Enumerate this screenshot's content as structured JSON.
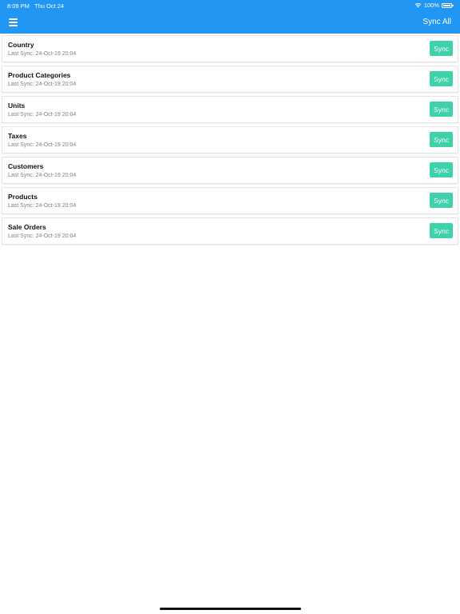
{
  "status_bar": {
    "time": "8:09 PM",
    "date": "Thu Oct 24",
    "battery": "100%"
  },
  "header": {
    "sync_all_label": "Sync All"
  },
  "items": [
    {
      "title": "Country",
      "last_sync": "Last Sync: 24-Oct-19 20:04",
      "button": "Sync"
    },
    {
      "title": "Product Categories",
      "last_sync": "Last Sync: 24-Oct-19 20:04",
      "button": "Sync"
    },
    {
      "title": "Units",
      "last_sync": "Last Sync: 24-Oct-19 20:04",
      "button": "Sync"
    },
    {
      "title": "Taxes",
      "last_sync": "Last Sync: 24-Oct-19 20:04",
      "button": "Sync"
    },
    {
      "title": "Customers",
      "last_sync": "Last Sync: 24-Oct-19 20:04",
      "button": "Sync"
    },
    {
      "title": "Products",
      "last_sync": "Last Sync: 24-Oct-19 20:04",
      "button": "Sync"
    },
    {
      "title": "Sale Orders",
      "last_sync": "Last Sync: 24-Oct-19 20:04",
      "button": "Sync"
    }
  ],
  "colors": {
    "header": "#2196f3",
    "sync_button": "#3fd1a9"
  }
}
